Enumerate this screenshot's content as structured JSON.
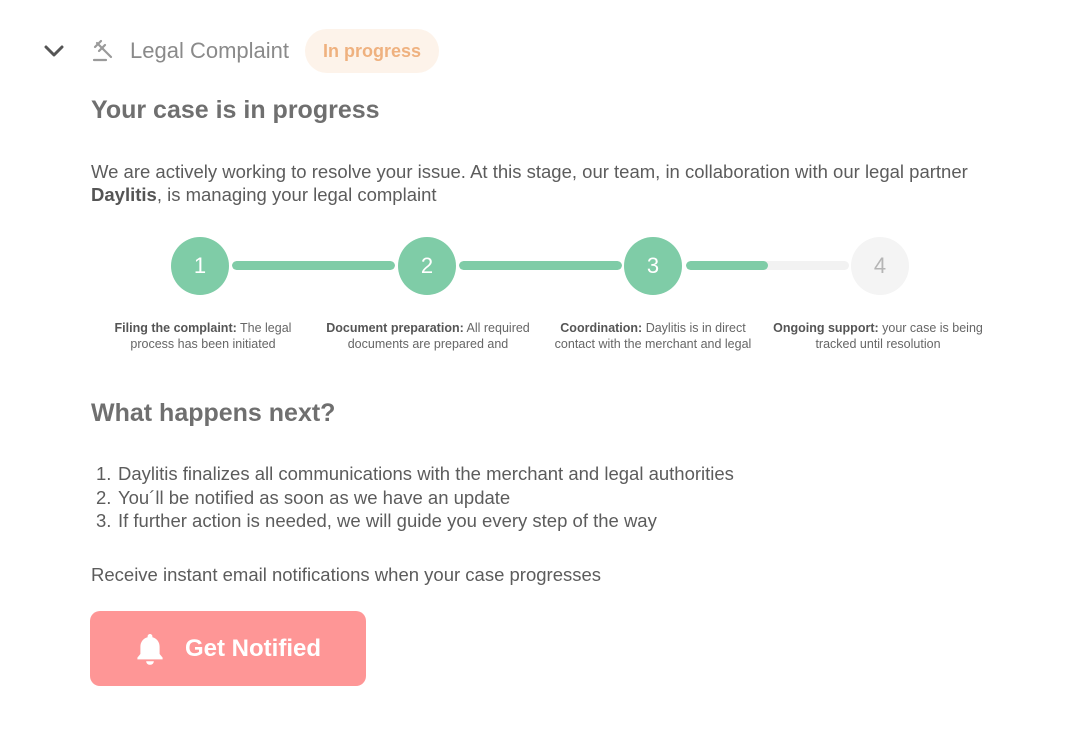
{
  "header": {
    "title": "Legal Complaint",
    "status_badge": "In progress",
    "colors": {
      "badge_bg": "#fdf3ea",
      "badge_text": "#efb17f"
    }
  },
  "main": {
    "heading": "Your case is in progress",
    "intro_before": "We are actively working to resolve your issue. At this stage, our team, in collaboration with our legal partner ",
    "intro_partner": "Daylitis",
    "intro_after": ", is managing your legal complaint"
  },
  "progress": {
    "current_step": 3,
    "connector_fill": [
      1.0,
      1.0,
      0.5
    ],
    "accent_color": "#7fcca7",
    "steps": [
      {
        "number": "1",
        "title": "Filing the complaint:",
        "text": " The legal process has been initiated",
        "state": "done"
      },
      {
        "number": "2",
        "title": "Document preparation:",
        "text": " All required documents are prepared and",
        "state": "done"
      },
      {
        "number": "3",
        "title": "Coordination:",
        "text": " Daylitis is in direct contact with the merchant and legal",
        "state": "active"
      },
      {
        "number": "4",
        "title": "Ongoing support:",
        "text": " your case is being tracked until resolution",
        "state": "todo"
      }
    ]
  },
  "next": {
    "heading": "What happens next?",
    "items": [
      {
        "num": "1.",
        "text": "Daylitis finalizes all communications with the merchant and legal authorities"
      },
      {
        "num": "2.",
        "text": "You´ll be notified as soon as we have an update"
      },
      {
        "num": "3.",
        "text": "If further action is needed, we will guide you every step of the way"
      }
    ]
  },
  "notify": {
    "text": "Receive instant email notifications when your case progresses",
    "button_label": "Get Notified",
    "button_icon": "bell-icon",
    "button_color": "#fe9696"
  },
  "icons": {
    "collapse": "chevron-down-icon",
    "section": "gavel-icon"
  }
}
